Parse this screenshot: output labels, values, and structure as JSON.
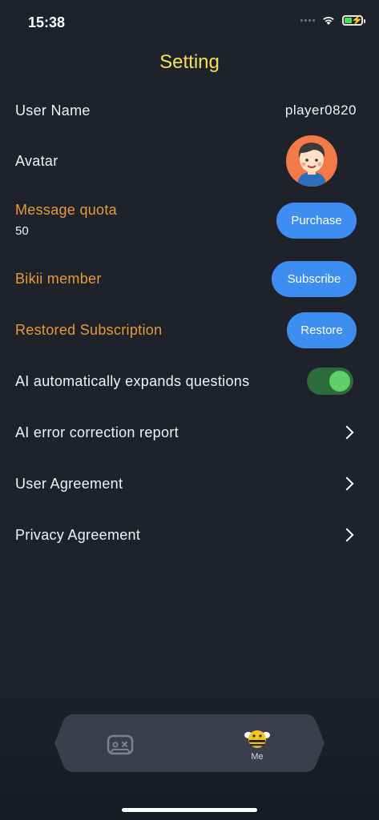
{
  "status": {
    "time": "15:38"
  },
  "title": "Setting",
  "rows": {
    "user_name": {
      "label": "User Name",
      "value": "player0820"
    },
    "avatar": {
      "label": "Avatar"
    },
    "message_quota": {
      "label": "Message quota",
      "value": "50",
      "button": "Purchase"
    },
    "member": {
      "label": "Bikii member",
      "button": "Subscribe"
    },
    "restore": {
      "label": "Restored Subscription",
      "button": "Restore"
    },
    "ai_expand": {
      "label": "AI automatically expands questions",
      "toggle_on": true
    },
    "error_report": {
      "label": "AI error correction report"
    },
    "user_agreement": {
      "label": "User Agreement"
    },
    "privacy_agreement": {
      "label": "Privacy Agreement"
    }
  },
  "tabbar": {
    "tabs": [
      {
        "icon": "gamepad-icon",
        "label": ""
      },
      {
        "icon": "bee-icon",
        "label": "Me"
      }
    ]
  },
  "colors": {
    "background": "#1f222b",
    "title": "#f4e04d",
    "accent_label": "#e69a3a",
    "button": "#3d8ef0",
    "toggle_track": "#2e6b3d",
    "toggle_knob": "#5fd068"
  }
}
